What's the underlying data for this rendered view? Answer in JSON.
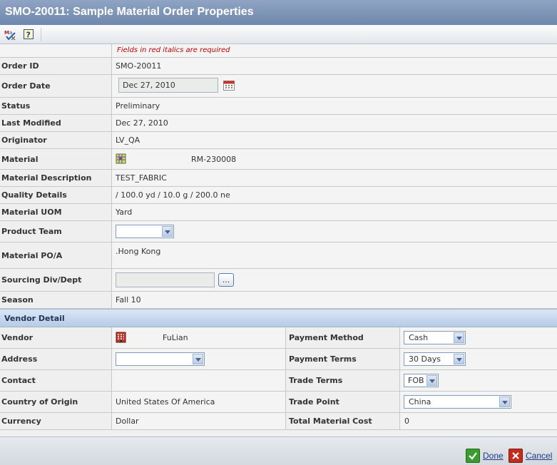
{
  "window": {
    "title": "SMO-20011: Sample Material Order Properties"
  },
  "toolbar": {
    "icons": [
      "spell-check-icon",
      "help-icon"
    ]
  },
  "required_note": "Fields in red italics are required",
  "fields": {
    "order_id": {
      "label": "Order ID",
      "value": "SMO-20011"
    },
    "order_date": {
      "label": "Order Date",
      "value": "Dec 27, 2010"
    },
    "status": {
      "label": "Status",
      "value": "Preliminary"
    },
    "last_modified": {
      "label": "Last Modified",
      "value": "Dec 27, 2010"
    },
    "originator": {
      "label": "Originator",
      "value": "LV_QA"
    },
    "material": {
      "label": "Material",
      "value": "RM-230008"
    },
    "material_description": {
      "label": "Material Description",
      "value": "TEST_FABRIC"
    },
    "quality_details": {
      "label": "Quality Details",
      "value": "/ 100.0 yd / 10.0 g / 200.0 ne"
    },
    "material_uom": {
      "label": "Material UOM",
      "value": "Yard"
    },
    "product_team": {
      "label": "Product Team",
      "value": ""
    },
    "material_po_a": {
      "label": "Material PO/A",
      "value": ".Hong Kong"
    },
    "sourcing_div_dept": {
      "label": "Sourcing Div/Dept",
      "value": "",
      "button": "..."
    },
    "season": {
      "label": "Season",
      "value": "Fall 10"
    }
  },
  "vendor_section": {
    "title": "Vendor Detail",
    "vendor": {
      "label": "Vendor",
      "value": "FuLian"
    },
    "address": {
      "label": "Address",
      "value": ""
    },
    "contact": {
      "label": "Contact",
      "value": ""
    },
    "country_of_origin": {
      "label": "Country of Origin",
      "value": "United States Of America"
    },
    "currency": {
      "label": "Currency",
      "value": "Dollar"
    },
    "payment_method": {
      "label": "Payment Method",
      "value": "Cash"
    },
    "payment_terms": {
      "label": "Payment Terms",
      "value": "30 Days"
    },
    "trade_terms": {
      "label": "Trade Terms",
      "value": "FOB"
    },
    "trade_point": {
      "label": "Trade Point",
      "value": "China"
    },
    "total_material_cost": {
      "label": "Total Material Cost",
      "value": "0"
    }
  },
  "footer": {
    "done_label": "Done",
    "cancel_label": "Cancel"
  },
  "colors": {
    "title_bar": "#7a90b5",
    "required_text": "#c00000",
    "section_bar": "#c5d6ed",
    "link": "#1e3a8a",
    "done_green": "#3a9b2e",
    "cancel_red": "#c42b1c"
  }
}
